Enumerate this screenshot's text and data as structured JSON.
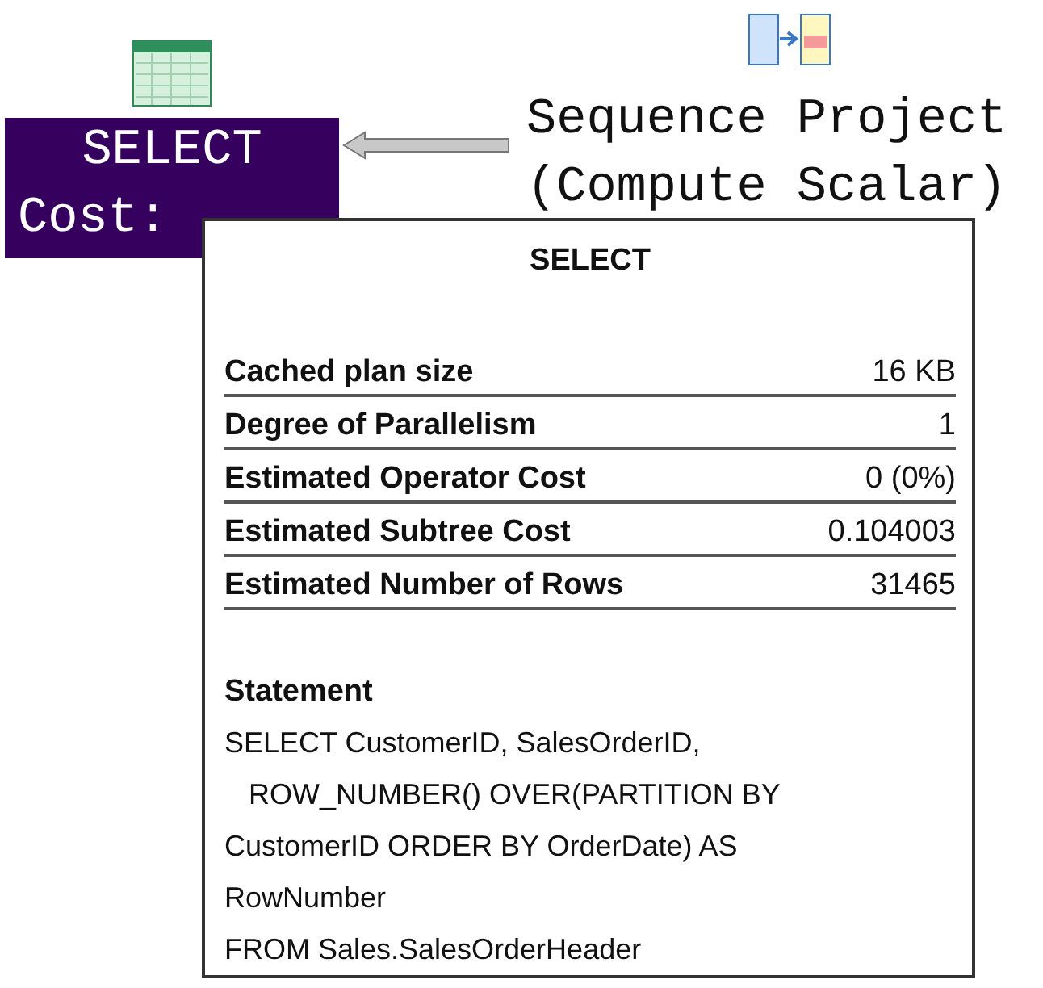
{
  "nodes": [
    {
      "kind": "select",
      "title": "SELECT",
      "cost": "Cost:"
    },
    {
      "kind": "sequence",
      "title": "Sequence Project",
      "subtitle": "(Compute Scalar)"
    }
  ],
  "tooltip": {
    "title": "SELECT",
    "rows": [
      {
        "label": "Cached plan size",
        "value": "16 KB"
      },
      {
        "label": "Degree of Parallelism",
        "value": "1"
      },
      {
        "label": "Estimated Operator Cost",
        "value": "0 (0%)"
      },
      {
        "label": "Estimated Subtree Cost",
        "value": "0.104003"
      },
      {
        "label": "Estimated Number of Rows",
        "value": "31465"
      }
    ],
    "statement_label": "Statement",
    "statement": "SELECT CustomerID, SalesOrderID,\n   ROW_NUMBER() OVER(PARTITION BY\nCustomerID ORDER BY OrderDate) AS\nRowNumber\nFROM Sales.SalesOrderHeader"
  }
}
